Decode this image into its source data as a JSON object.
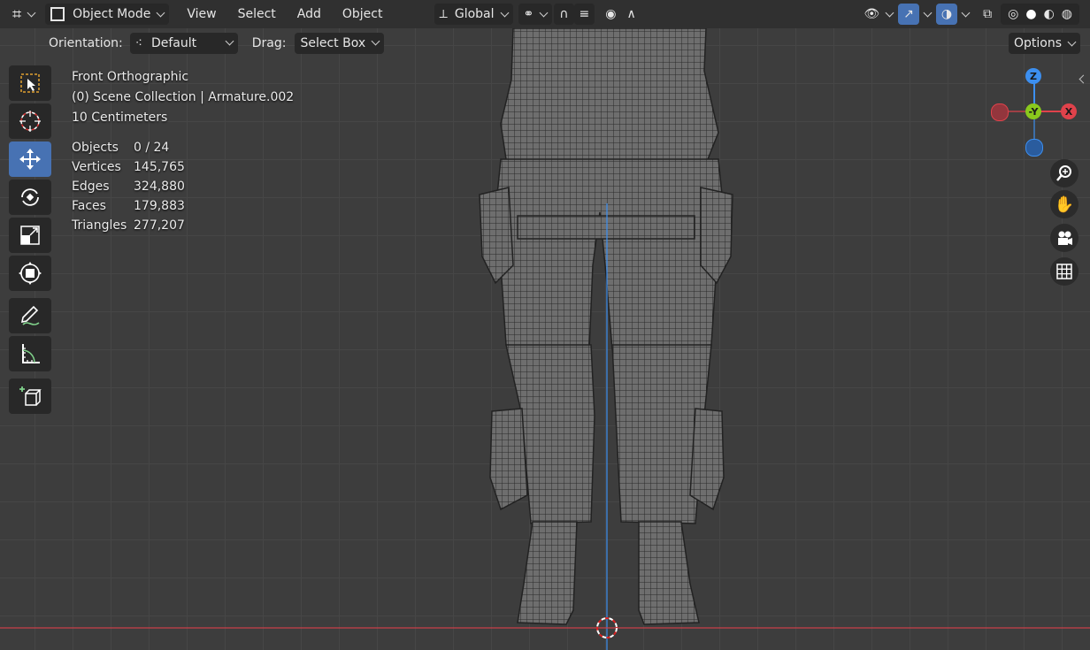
{
  "header": {
    "mode": "Object Mode",
    "menus": [
      "View",
      "Select",
      "Add",
      "Object"
    ],
    "transform_orientation": "Global"
  },
  "tool_settings": {
    "orientation_label": "Orientation:",
    "orientation_value": "Default",
    "drag_label": "Drag:",
    "drag_value": "Select Box",
    "options_label": "Options"
  },
  "viewport_info": {
    "view_name": "Front Orthographic",
    "collection": "(0) Scene Collection | Armature.002",
    "scale": "10 Centimeters"
  },
  "stats": [
    {
      "label": "Objects",
      "value": "0 / 24"
    },
    {
      "label": "Vertices",
      "value": "145,765"
    },
    {
      "label": "Edges",
      "value": "324,880"
    },
    {
      "label": "Faces",
      "value": "179,883"
    },
    {
      "label": "Triangles",
      "value": "277,207"
    }
  ],
  "gizmo": {
    "z": "Z",
    "y": "-Y",
    "x": "X"
  },
  "colors": {
    "active_tool": "#4772b3",
    "x_axis": "#e0424b",
    "y_axis": "#8ac91d",
    "z_axis": "#3c8ff0",
    "header_bg": "#303030",
    "viewport_bg": "#3d3d3d"
  }
}
